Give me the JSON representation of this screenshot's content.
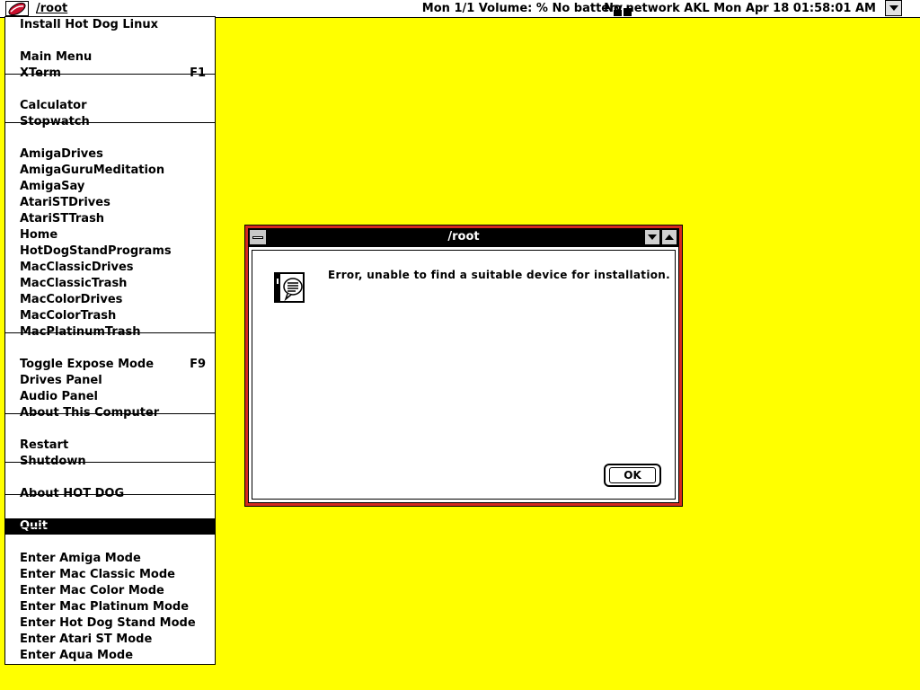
{
  "menubar": {
    "title": "/root",
    "status_left": "Mon 1/1  Volume: %  No battery",
    "status_right": "No network  AKL Mon Apr 18 01:58:01 AM",
    "icons": {
      "app": "hotdog-icon",
      "network": "network-icon",
      "dropdown": "chevron-down-icon"
    }
  },
  "menu": {
    "items": [
      {
        "label": "Install Hot Dog Linux",
        "shortcut": ""
      },
      {
        "label": "Main Menu",
        "shortcut": ""
      },
      {
        "label": "XTerm",
        "shortcut": "F1"
      },
      {
        "label": "Calculator",
        "shortcut": ""
      },
      {
        "label": "Stopwatch",
        "shortcut": ""
      },
      {
        "label": "AmigaDrives",
        "shortcut": ""
      },
      {
        "label": "AmigaGuruMeditation",
        "shortcut": ""
      },
      {
        "label": "AmigaSay",
        "shortcut": ""
      },
      {
        "label": "AtariSTDrives",
        "shortcut": ""
      },
      {
        "label": "AtariSTTrash",
        "shortcut": ""
      },
      {
        "label": "Home",
        "shortcut": ""
      },
      {
        "label": "HotDogStandPrograms",
        "shortcut": ""
      },
      {
        "label": "MacClassicDrives",
        "shortcut": ""
      },
      {
        "label": "MacClassicTrash",
        "shortcut": ""
      },
      {
        "label": "MacColorDrives",
        "shortcut": ""
      },
      {
        "label": "MacColorTrash",
        "shortcut": ""
      },
      {
        "label": "MacPlatinumTrash",
        "shortcut": ""
      },
      {
        "label": "Toggle Expose Mode",
        "shortcut": "F9"
      },
      {
        "label": "Drives Panel",
        "shortcut": ""
      },
      {
        "label": "Audio Panel",
        "shortcut": ""
      },
      {
        "label": "About This Computer",
        "shortcut": ""
      },
      {
        "label": "Restart",
        "shortcut": ""
      },
      {
        "label": "Shutdown",
        "shortcut": ""
      },
      {
        "label": "About HOT DOG",
        "shortcut": ""
      },
      {
        "label": "Quit",
        "shortcut": "",
        "selected": true
      },
      {
        "label": "Enter Amiga Mode",
        "shortcut": ""
      },
      {
        "label": "Enter Mac Classic Mode",
        "shortcut": ""
      },
      {
        "label": "Enter Mac Color Mode",
        "shortcut": ""
      },
      {
        "label": "Enter Mac Platinum Mode",
        "shortcut": ""
      },
      {
        "label": "Enter Hot Dog Stand Mode",
        "shortcut": ""
      },
      {
        "label": "Enter Atari ST Mode",
        "shortcut": ""
      },
      {
        "label": "Enter Aqua Mode",
        "shortcut": ""
      }
    ]
  },
  "dialog": {
    "title": "/root",
    "message": "Error, unable to find a suitable device for installation.",
    "ok_label": "OK",
    "icon": "alert-note-icon"
  },
  "colors": {
    "desktop": "#ffff00",
    "dialog_frame": "#d42a1f",
    "titlebar": "#000000",
    "menu_selected": "#000000"
  }
}
